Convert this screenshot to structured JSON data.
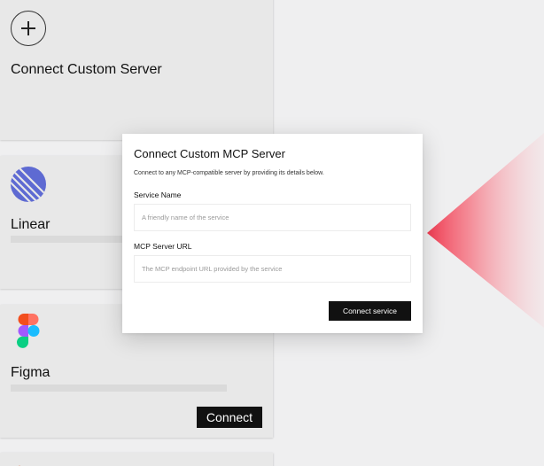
{
  "cards": {
    "custom": {
      "title": "Connect Custom Server",
      "icon": "plus-icon"
    },
    "linear": {
      "title": "Linear",
      "icon": "linear-logo-icon"
    },
    "figma": {
      "title": "Figma",
      "icon": "figma-logo-icon",
      "button_label": "Connect"
    },
    "next": {
      "icon": "service-logo-icon"
    }
  },
  "modal": {
    "title": "Connect Custom MCP Server",
    "description": "Connect to any MCP-compatible server by providing its details below.",
    "service_name_label": "Service Name",
    "service_name_placeholder": "A friendly name of the service",
    "service_name_value": "",
    "server_url_label": "MCP Server URL",
    "server_url_placeholder": "The MCP endpoint URL provided by the service",
    "server_url_value": "",
    "submit_label": "Connect service"
  },
  "colors": {
    "accent_red": "#f03c52",
    "button_dark": "#111111",
    "card_bg": "#e8e8e8",
    "linear_blue": "#5e6ad2"
  }
}
